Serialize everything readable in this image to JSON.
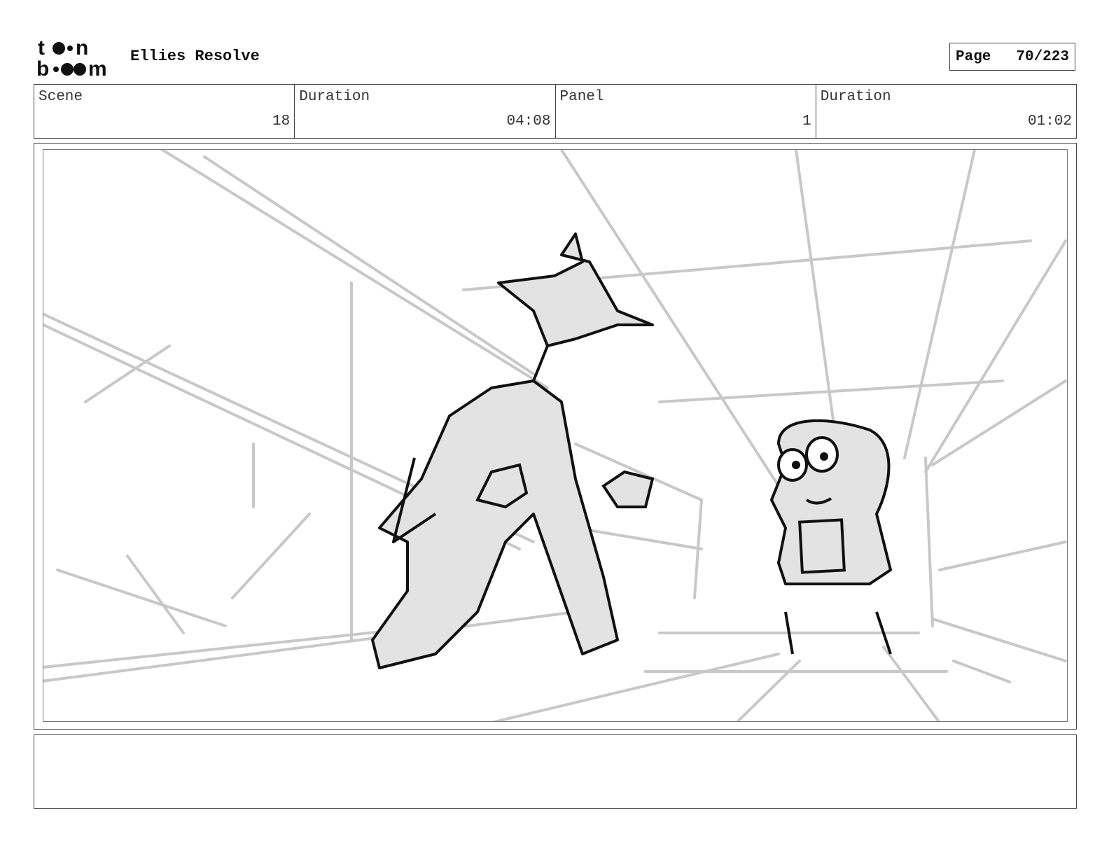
{
  "header": {
    "logo_text": "toon boom",
    "project_title": "Ellies Resolve",
    "page_label": "Page",
    "page_number": "70/223"
  },
  "info": {
    "scene_label": "Scene",
    "scene_value": "18",
    "scene_duration_label": "Duration",
    "scene_duration_value": "04:08",
    "panel_label": "Panel",
    "panel_value": "1",
    "panel_duration_label": "Duration",
    "panel_duration_value": "01:02"
  },
  "panel": {
    "description": ""
  },
  "notes": {
    "text": ""
  }
}
